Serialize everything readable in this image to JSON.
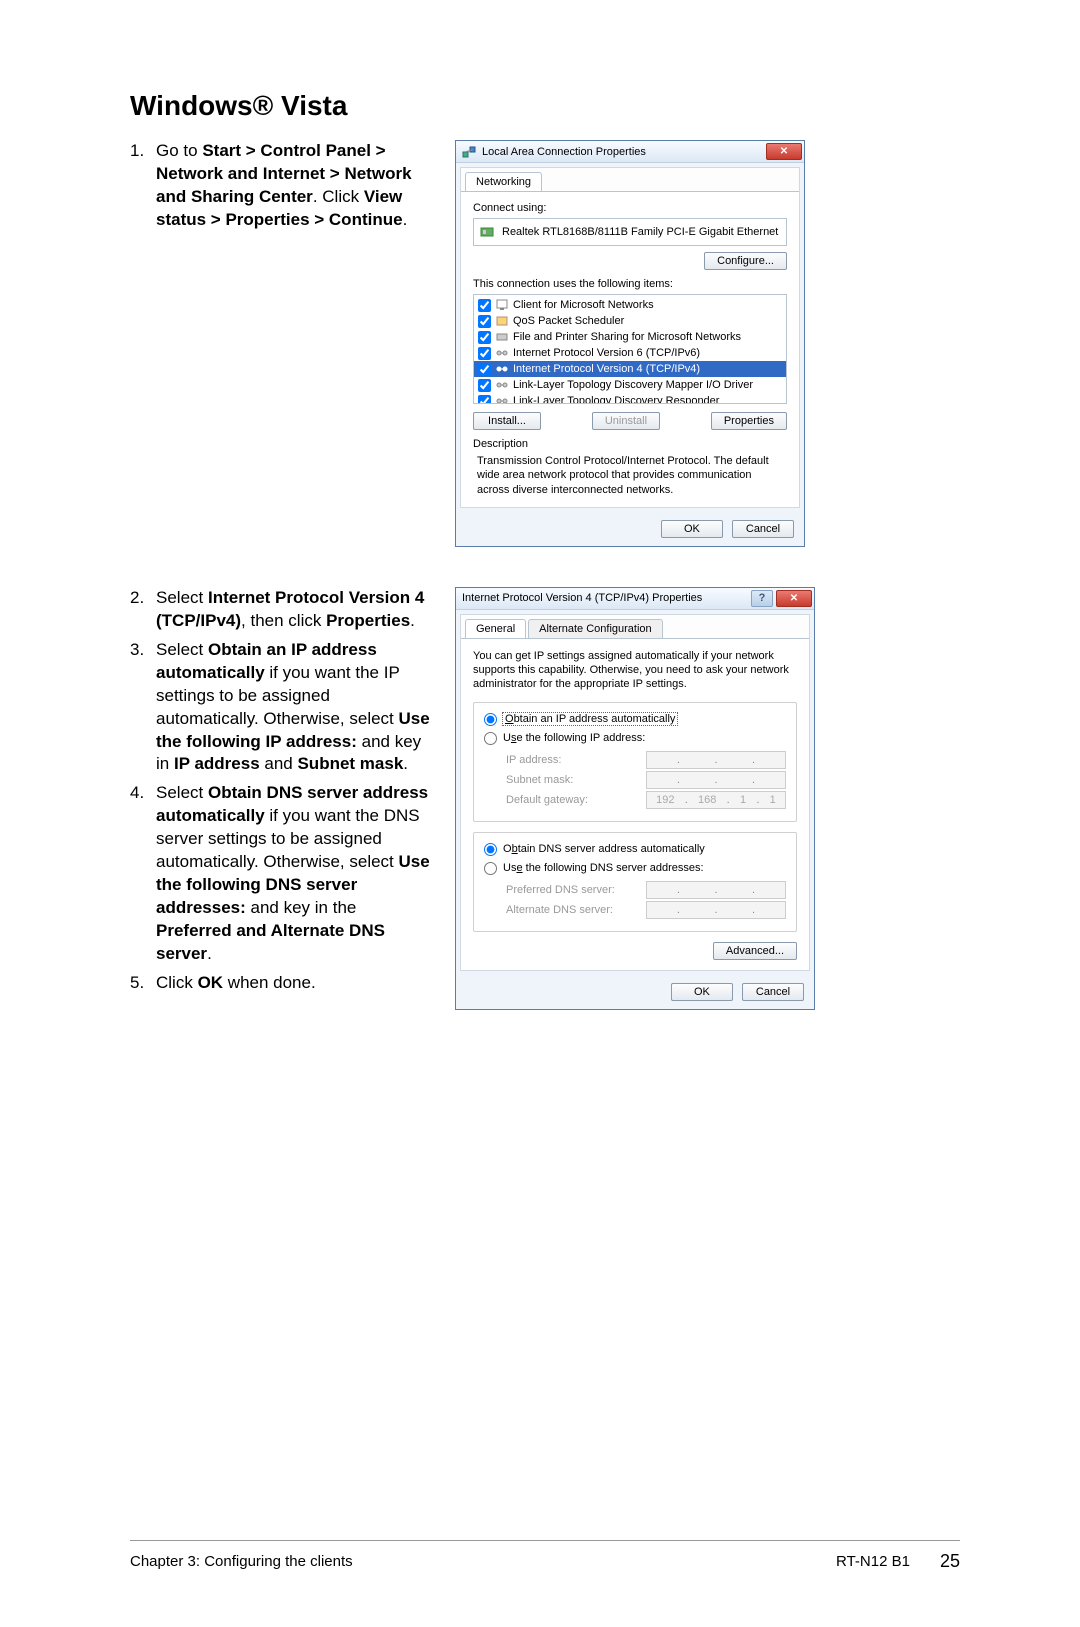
{
  "heading": "Windows® Vista",
  "steps": {
    "s1": {
      "num": "1.",
      "t1": "Go to ",
      "b1": "Start > Control Panel > Network and Internet > Network and Sharing Center",
      "t2": ". Click ",
      "b2": "View status > Properties > Continue",
      "t3": "."
    },
    "s2": {
      "num": "2.",
      "t1": "Select ",
      "b1": "Internet Protocol Version 4 (TCP/IPv4)",
      "t2": ", then click ",
      "b2": "Properties",
      "t3": "."
    },
    "s3": {
      "num": "3.",
      "t1": "Select ",
      "b1": "Obtain an IP address automatically",
      "t2": " if you want the IP settings to be assigned automatically. Otherwise, select ",
      "b2": "Use the following IP address:",
      "t3": " and key in ",
      "b3": "IP address",
      "t4": " and ",
      "b4": "Subnet mask",
      "t5": "."
    },
    "s4": {
      "num": "4.",
      "t1": "Select ",
      "b1": "Obtain DNS server address automatically",
      "t2": " if you want the DNS server settings to be assigned automatically. Otherwise, select ",
      "b2": "Use the following DNS server addresses:",
      "t3": " and key in the ",
      "b3": "Preferred and Alternate DNS server",
      "t4": "."
    },
    "s5": {
      "num": "5.",
      "t1": "Click ",
      "b1": "OK",
      "t2": " when done."
    }
  },
  "dialog1": {
    "title": "Local Area Connection Properties",
    "tab": "Networking",
    "connect_using": "Connect using:",
    "adapter": "Realtek RTL8168B/8111B Family PCI-E Gigabit Ethernet",
    "configure": "Configure...",
    "uses_items": "This connection uses the following items:",
    "items": [
      "Client for Microsoft Networks",
      "QoS Packet Scheduler",
      "File and Printer Sharing for Microsoft Networks",
      "Internet Protocol Version 6 (TCP/IPv6)",
      "Internet Protocol Version 4 (TCP/IPv4)",
      "Link-Layer Topology Discovery Mapper I/O Driver",
      "Link-Layer Topology Discovery Responder"
    ],
    "install": "Install...",
    "uninstall": "Uninstall",
    "properties": "Properties",
    "description_label": "Description",
    "description": "Transmission Control Protocol/Internet Protocol. The default wide area network protocol that provides communication across diverse interconnected networks.",
    "ok": "OK",
    "cancel": "Cancel"
  },
  "dialog2": {
    "title": "Internet Protocol Version 4 (TCP/IPv4) Properties",
    "tab_general": "General",
    "tab_alt": "Alternate Configuration",
    "intro": "You can get IP settings assigned automatically if your network supports this capability. Otherwise, you need to ask your network administrator for the appropriate IP settings.",
    "opt_auto_ip": "Obtain an IP address automatically",
    "opt_manual_ip": "Use the following IP address:",
    "ip_address": "IP address:",
    "subnet": "Subnet mask:",
    "gateway": "Default gateway:",
    "gateway_val": [
      "192",
      "168",
      "1",
      "1"
    ],
    "opt_auto_dns": "Obtain DNS server address automatically",
    "opt_manual_dns": "Use the following DNS server addresses:",
    "pref_dns": "Preferred DNS server:",
    "alt_dns": "Alternate DNS server:",
    "advanced": "Advanced...",
    "ok": "OK",
    "cancel": "Cancel"
  },
  "footer": {
    "chapter": "Chapter 3: Configuring the clients",
    "model": "RT-N12 B1",
    "page": "25"
  }
}
